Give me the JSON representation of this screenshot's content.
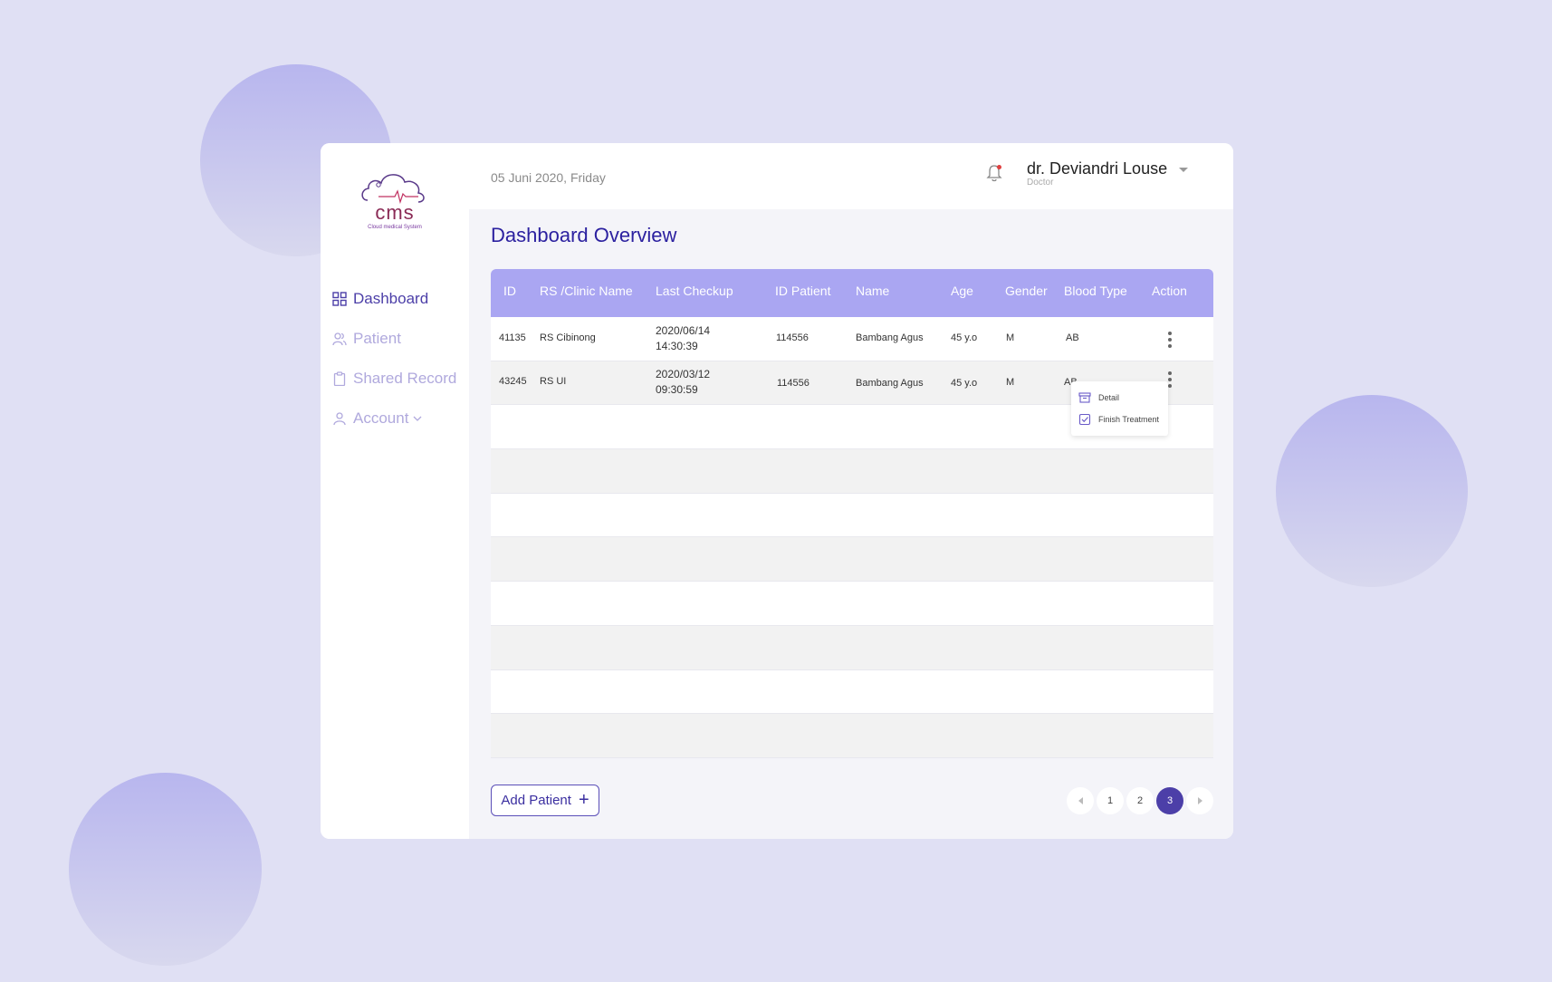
{
  "app": {
    "logo_text": "cms",
    "logo_subtitle": "Cloud medical System"
  },
  "sidebar": {
    "items": [
      {
        "label": "Dashboard",
        "icon": "grid-icon",
        "active": true
      },
      {
        "label": "Patient",
        "icon": "users-icon",
        "active": false
      },
      {
        "label": "Shared Record",
        "icon": "clipboard-icon",
        "active": false
      },
      {
        "label": "Account",
        "icon": "user-icon",
        "active": false
      }
    ]
  },
  "header": {
    "date": "05 Juni 2020, Friday",
    "user_name": "dr. Deviandri Louse",
    "user_role": "Doctor"
  },
  "main": {
    "title": "Dashboard Overview",
    "table": {
      "columns": [
        "ID",
        "RS /Clinic Name",
        "Last Checkup",
        "ID Patient",
        "Name",
        "Age",
        "Gender",
        "Blood Type",
        "Action"
      ],
      "rows": [
        {
          "id": "41135",
          "clinic": "RS Cibinong",
          "date": "2020/06/14",
          "time": "14:30:39",
          "patient_id": "114556",
          "name": "Bambang Agus",
          "age": "45 y.o",
          "gender": "M",
          "blood": "AB"
        },
        {
          "id": "43245",
          "clinic": "RS UI",
          "date": "2020/03/12",
          "time": "09:30:59",
          "patient_id": "114556",
          "name": "Bambang Agus",
          "age": "45 y.o",
          "gender": "M",
          "blood": "AB"
        }
      ]
    },
    "action_menu": {
      "detail": "Detail",
      "finish": "Finish Treatment"
    },
    "add_button": "Add Patient",
    "pagination": {
      "pages": [
        "1",
        "2",
        "3"
      ],
      "current": "3"
    }
  },
  "colors": {
    "background": "#e0e0f4",
    "accent": "#4c3fa8",
    "table_header": "#aaa6f2",
    "logo": "#8a2a55"
  }
}
